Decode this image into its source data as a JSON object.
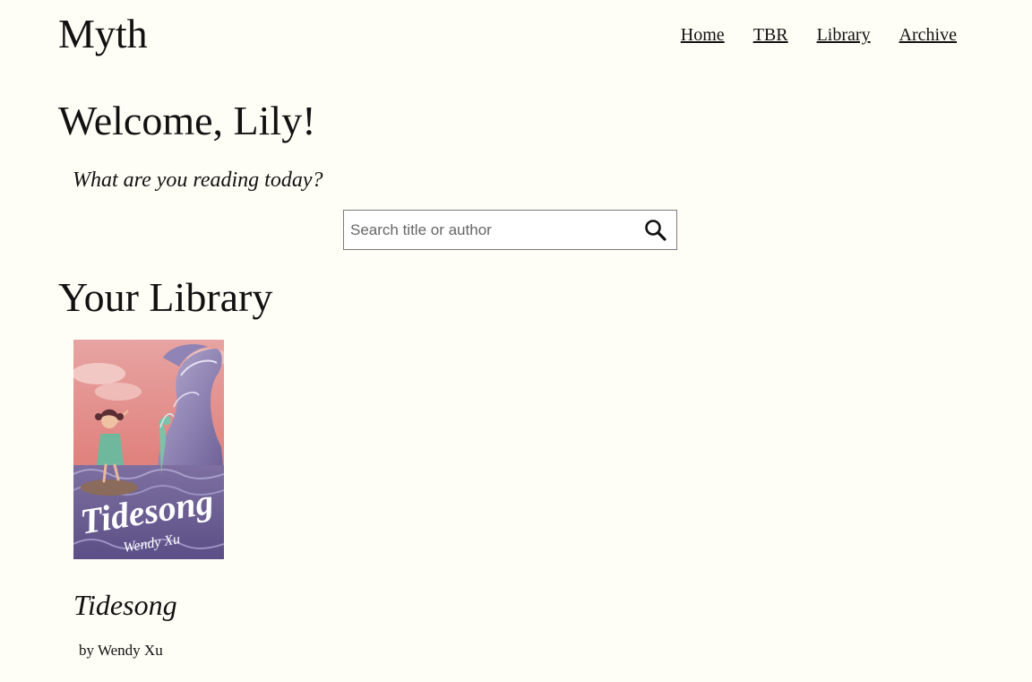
{
  "site": {
    "title": "Myth"
  },
  "nav": {
    "items": [
      {
        "label": "Home"
      },
      {
        "label": "TBR"
      },
      {
        "label": "Library"
      },
      {
        "label": "Archive"
      }
    ]
  },
  "welcome": {
    "heading": "Welcome, Lily!",
    "prompt": "What are you reading today?"
  },
  "search": {
    "placeholder": "Search title or author",
    "value": "",
    "icon": "search-icon"
  },
  "library": {
    "heading": "Your Library",
    "books": [
      {
        "title": "Tidesong",
        "author": "by Wendy Xu",
        "cover_text_title": "Tidesong",
        "cover_text_author": "Wendy Xu"
      }
    ]
  },
  "colors": {
    "background": "#fffef6",
    "text": "#111111",
    "search_border": "#7a7a7a"
  }
}
